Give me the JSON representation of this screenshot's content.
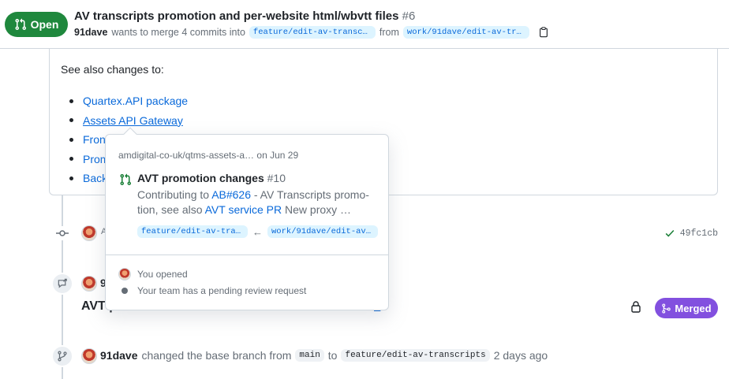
{
  "header": {
    "status_label": "Open",
    "title": "AV transcripts promotion and per-website html/wbvtt files",
    "number": "#6",
    "author": "91dave",
    "merge_text": "wants to merge 4 commits into",
    "base_branch": "feature/edit-av-transcripts",
    "from_text": "from",
    "head_branch": "work/91dave/edit-av-transcrip…"
  },
  "comment": {
    "see_also": "See also changes to:",
    "links": [
      "Quartex.API package",
      "Assets API Gateway",
      "Front",
      "Prom",
      "Back"
    ]
  },
  "hovercard": {
    "repo": "amdigital-co-uk/qtms-assets-a…",
    "date": "on Jun 29",
    "pr_title": "AVT promotion changes",
    "pr_number": "#10",
    "desc_prefix": "Contributing to",
    "desc_link1": "AB#626",
    "desc_middle": "- AV Transcripts promo­tion, see also",
    "desc_link2": "AVT service PR",
    "desc_suffix": "New proxy …",
    "base_branch": "feature/edit-av-trans…",
    "arrow": "←",
    "head_branch": "work/91dave/edit-av-t…",
    "opened_text": "You opened",
    "pending_text": "Your team has a pending review request"
  },
  "timeline": {
    "commit_author_initial": "A",
    "commit_sha": "49fc1cb",
    "xref_author": "91",
    "xref_title": "AVT p",
    "xref_number": "2",
    "merged_label": "Merged",
    "branch_change": {
      "author": "91dave",
      "text1": "changed the base branch from",
      "from_branch": "main",
      "to_text": "to",
      "to_branch": "feature/edit-av-transcripts",
      "time": "2 days ago"
    }
  },
  "colors": {
    "open_green": "#1f883d",
    "merged_purple": "#8250df",
    "link_blue": "#0969da",
    "branch_bg": "#ddf4ff"
  }
}
